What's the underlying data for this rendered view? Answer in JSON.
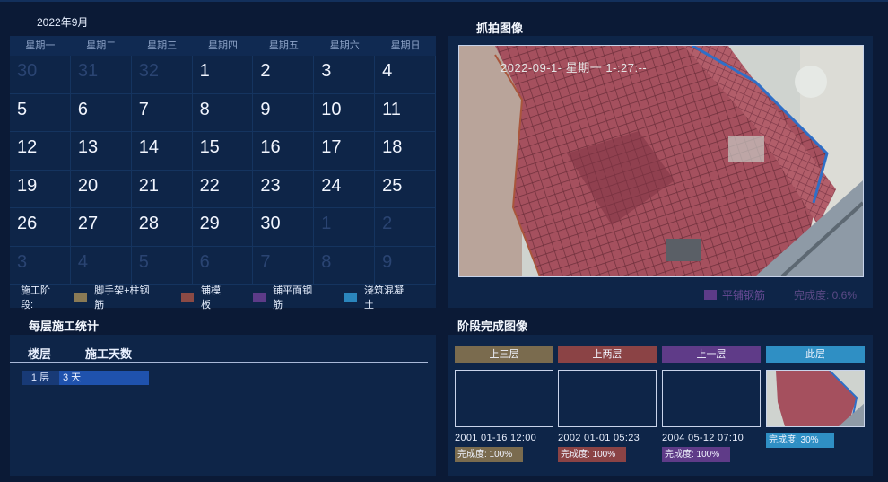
{
  "calendar": {
    "month": "2022年9月",
    "weekdays": [
      "星期一",
      "星期二",
      "星期三",
      "星期四",
      "星期五",
      "星期六",
      "星期日"
    ],
    "days": [
      "30",
      "31",
      "32",
      "1",
      "2",
      "3",
      "4",
      "5",
      "6",
      "7",
      "8",
      "9",
      "10",
      "11",
      "12",
      "13",
      "14",
      "15",
      "16",
      "17",
      "18",
      "19",
      "20",
      "21",
      "22",
      "23",
      "24",
      "25",
      "26",
      "27",
      "28",
      "29",
      "30",
      "1",
      "2",
      "3",
      "4",
      "5",
      "6",
      "7",
      "8",
      "9"
    ],
    "legend_lead": "施工阶段:",
    "legend": [
      {
        "label": "脚手架+柱钢筋",
        "color": "#8a7a55"
      },
      {
        "label": "铺模板",
        "color": "#8b4a45"
      },
      {
        "label": "铺平面钢筋",
        "color": "#5d3b88"
      },
      {
        "label": "浇筑混凝土",
        "color": "#2b86bd"
      }
    ]
  },
  "capture": {
    "title": "抓拍图像",
    "stamp": "2022-09-1- 星期一 1-:27:--",
    "phase": "平铺钢筋",
    "progress": "完成度: 0.6%"
  },
  "floor_stats": {
    "title": "每层施工统计",
    "col_floor": "楼层",
    "col_days": "施工天数",
    "rows": [
      {
        "floor": "1 层",
        "days": "3 天"
      }
    ]
  },
  "stages": {
    "title": "阶段完成图像",
    "items": [
      {
        "label": "上三层",
        "time": "2001 01-16 12:00",
        "pct": "完成度: 100%",
        "color": "#7a6b4e"
      },
      {
        "label": "上两层",
        "time": "2002 01-01 05:23",
        "pct": "完成度: 100%",
        "color": "#8b4345"
      },
      {
        "label": "上一层",
        "time": "2004 05-12 07:10",
        "pct": "完成度: 100%",
        "color": "#5f3b88"
      },
      {
        "label": "此层",
        "time": "",
        "pct": "完成度: 30%",
        "color": "#2f8fc4"
      }
    ]
  }
}
